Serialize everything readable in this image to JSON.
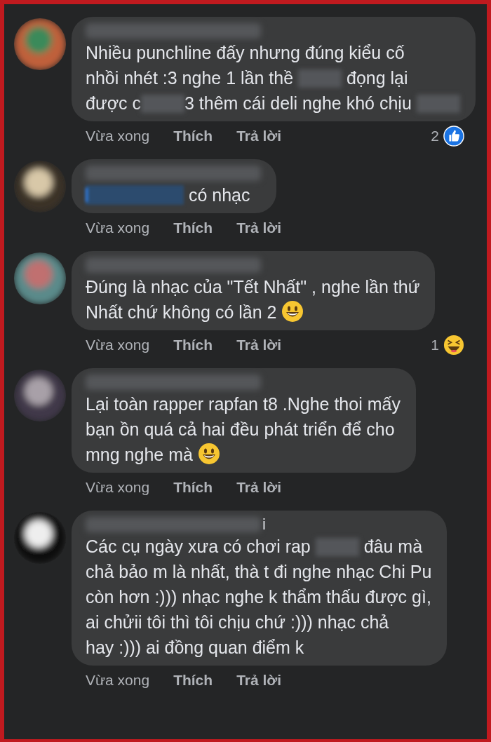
{
  "comments": [
    {
      "name": {
        "blurred": true
      },
      "body": [
        {
          "kind": "text",
          "text": "Nhiều punchline đấy nhưng đúng kiểu cố"
        },
        {
          "kind": "break"
        },
        {
          "kind": "text",
          "text": "nhồi nhét :3 nghe 1 lần thề "
        },
        {
          "kind": "blur"
        },
        {
          "kind": "text",
          "text": " đọng lại"
        },
        {
          "kind": "break"
        },
        {
          "kind": "text",
          "text": "được c"
        },
        {
          "kind": "blur"
        },
        {
          "kind": "text",
          "text": "3 thêm cái deli nghe khó chịu "
        },
        {
          "kind": "blur"
        }
      ],
      "time": "Vừa xong",
      "like": "Thích",
      "reply": "Trả lời",
      "reaction": {
        "kind": "like",
        "count": "2"
      }
    },
    {
      "name": {
        "blurred": true
      },
      "body": [
        {
          "kind": "mention"
        },
        {
          "kind": "text",
          "text": " có nhạc"
        }
      ],
      "time": "Vừa xong",
      "like": "Thích",
      "reply": "Trả lời"
    },
    {
      "name": {
        "blurred": true
      },
      "body": [
        {
          "kind": "text",
          "text": "Đúng là nhạc của \"Tết Nhất\" , nghe lần thứ"
        },
        {
          "kind": "break"
        },
        {
          "kind": "text",
          "text": "Nhất chứ không có lần 2 "
        },
        {
          "kind": "smiley"
        }
      ],
      "time": "Vừa xong",
      "like": "Thích",
      "reply": "Trả lời",
      "reaction": {
        "kind": "laugh",
        "count": "1"
      }
    },
    {
      "name": {
        "blurred": true
      },
      "body": [
        {
          "kind": "text",
          "text": "Lại toàn rapper rapfan t8 .Nghe thoi mấy"
        },
        {
          "kind": "break"
        },
        {
          "kind": "text",
          "text": "bạn ồn quá cả hai đều phát triển để cho"
        },
        {
          "kind": "break"
        },
        {
          "kind": "text",
          "text": "mng nghe mà "
        },
        {
          "kind": "smiley"
        }
      ],
      "time": "Vừa xong",
      "like": "Thích",
      "reply": "Trả lời"
    },
    {
      "name": {
        "blurred": true,
        "text": "i"
      },
      "body": [
        {
          "kind": "text",
          "text": "Các cụ ngày xưa có chơi rap "
        },
        {
          "kind": "blur"
        },
        {
          "kind": "text",
          "text": " đâu mà"
        },
        {
          "kind": "break"
        },
        {
          "kind": "text",
          "text": "chả bảo m là nhất, thà t đi nghe nhạc Chi Pu"
        },
        {
          "kind": "break"
        },
        {
          "kind": "text",
          "text": "còn hơn :))) nhạc nghe k thẩm thấu được gì,"
        },
        {
          "kind": "break"
        },
        {
          "kind": "text",
          "text": "ai chửii tôi thì tôi chịu chứ :))) nhạc chả"
        },
        {
          "kind": "break"
        },
        {
          "kind": "text",
          "text": "hay :))) ai đồng quan điểm k"
        }
      ],
      "time": "Vừa xong",
      "like": "Thích",
      "reply": "Trả lời"
    }
  ]
}
